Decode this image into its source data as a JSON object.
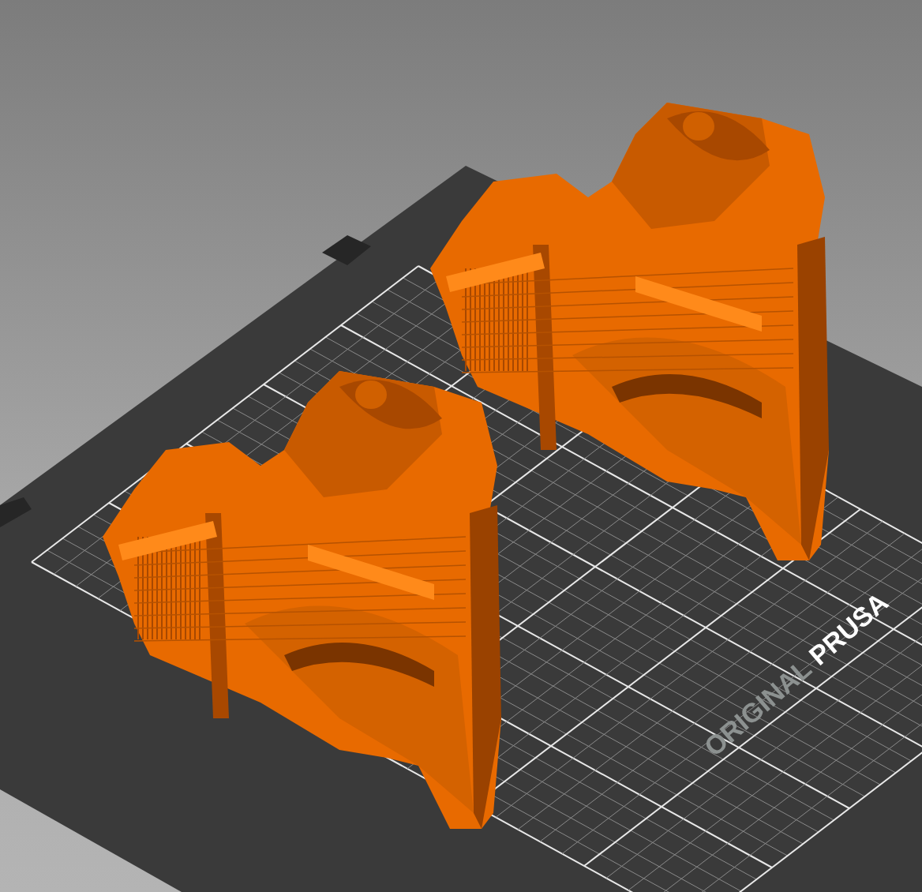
{
  "viewport": {
    "bed_logo": {
      "line_1": "ORIGINAL",
      "line_2": "PRUSA"
    }
  }
}
